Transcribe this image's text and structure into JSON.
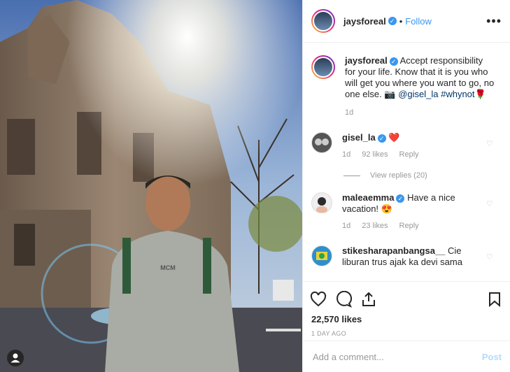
{
  "post": {
    "username": "jaysforeal",
    "follow_label": "Follow",
    "separator": "•",
    "more_label": "•••",
    "caption_text": "Accept responsibility for your life. Know that it is you who will get you where you want to go, no one else. 📷",
    "caption_mention": "@gisel_la",
    "caption_hashtag": "#whynot",
    "caption_emoji": "🌹",
    "caption_time": "1d",
    "photo_shirt_text": "MCM"
  },
  "comments": [
    {
      "username": "gisel_la",
      "text": "❤️",
      "time": "1d",
      "likes": "92 likes",
      "reply": "Reply",
      "verified": true
    },
    {
      "username": "maleaemma",
      "text": "Have a nice vacation! 😍",
      "time": "1d",
      "likes": "23 likes",
      "reply": "Reply",
      "verified": true
    },
    {
      "username": "stikesharapanbangsa__",
      "text": "Cie liburan trus ajak ka devi sama",
      "verified": false
    }
  ],
  "view_replies_label": "View replies (20)",
  "footer": {
    "likes_count": "22,570 likes",
    "time_ago": "1 DAY AGO",
    "comment_placeholder": "Add a comment...",
    "post_label": "Post"
  },
  "colors": {
    "accent": "#3897f0",
    "text": "#262626",
    "muted": "#999999",
    "heart": "#ed4956"
  },
  "icons": [
    "heart-icon",
    "comment-icon",
    "share-icon",
    "bookmark-icon",
    "user-tag-icon",
    "verified-badge-icon"
  ]
}
